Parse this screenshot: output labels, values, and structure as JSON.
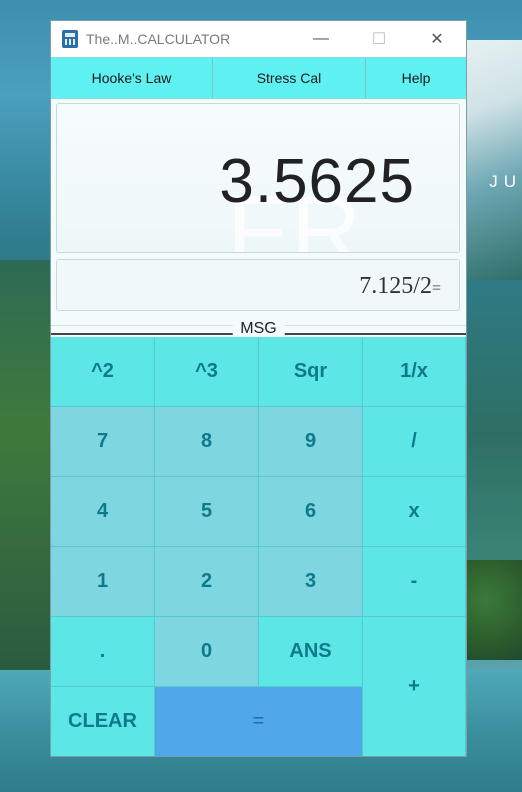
{
  "window": {
    "title": "The..M..CALCULATOR",
    "controls": {
      "minimize": "—",
      "maximize": "☐",
      "close": "✕"
    }
  },
  "menu": [
    {
      "label": "Hooke's Law"
    },
    {
      "label": "Stress Cal"
    },
    {
      "label": "Help"
    }
  ],
  "display": {
    "result": "3.5625",
    "expression": "7.125/2",
    "expression_suffix": "=",
    "watermark": "FR"
  },
  "msg_label": "MSG",
  "background_text": "JU",
  "keys": {
    "square": "^2",
    "cube": "^3",
    "sqrt": "Sqr",
    "reciprocal": "1/x",
    "seven": "7",
    "eight": "8",
    "nine": "9",
    "divide": "/",
    "four": "4",
    "five": "5",
    "six": "6",
    "multiply": "x",
    "one": "1",
    "two": "2",
    "three": "3",
    "minus": "-",
    "dot": ".",
    "zero": "0",
    "ans": "ANS",
    "plus": "+",
    "clear": "CLEAR",
    "equals": "="
  },
  "colors": {
    "menu_bg": "#5ff0f2",
    "key_bg": "#5de6e6",
    "digit_key_bg": "#7dd6e0",
    "equals_bg": "#4fa8ea",
    "key_text": "#0f7a8c"
  }
}
